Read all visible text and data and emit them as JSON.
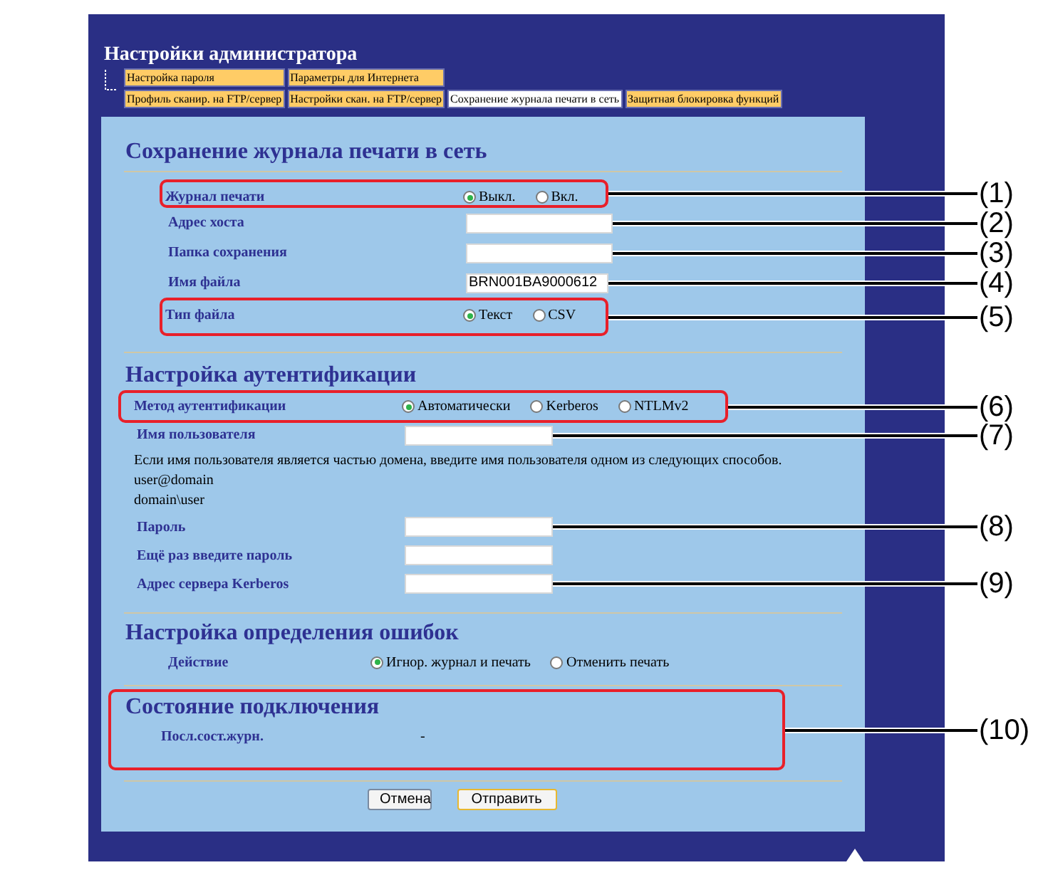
{
  "page_title": "Настройки администратора",
  "tab_rows": [
    {
      "tabs": [
        {
          "label": "Настройка пароля",
          "selected": false
        },
        {
          "label": "Параметры для Интернета",
          "selected": false
        }
      ]
    },
    {
      "tabs": [
        {
          "label": "Профиль сканир. на FTP/сервер",
          "selected": false
        },
        {
          "label": "Настройки скан. на FTP/сервер",
          "selected": false
        },
        {
          "label": "Сохранение журнала печати в сеть",
          "selected": true
        },
        {
          "label": "Защитная блокировка функций",
          "selected": false
        }
      ]
    }
  ],
  "sections": [
    {
      "title": "Сохранение журнала печати в сеть",
      "highlighted": false,
      "rows": [
        {
          "kind": "radio",
          "label": "Журнал печати",
          "highlighted": true,
          "callout": "(1)",
          "options": [
            {
              "label": "Выкл.",
              "selected": true
            },
            {
              "label": "Вкл.",
              "selected": false
            }
          ]
        },
        {
          "kind": "input",
          "label": "Адрес хоста",
          "highlighted": false,
          "callout": "(2)"
        },
        {
          "kind": "input",
          "label": "Папка сохранения",
          "highlighted": false,
          "callout": "(3)"
        },
        {
          "kind": "input",
          "label": "Имя файла",
          "highlighted": false,
          "callout": "(4)",
          "value": "BRN001BA9000612"
        },
        {
          "kind": "radio",
          "label": "Тип файла",
          "highlighted": true,
          "callout": "(5)",
          "options": [
            {
              "label": "Текст",
              "selected": true
            },
            {
              "label": "CSV",
              "selected": false
            }
          ]
        }
      ]
    },
    {
      "title": "Настройка аутентификации",
      "highlighted": false,
      "rows": [
        {
          "kind": "radio",
          "label": "Метод аутентификации",
          "highlighted": true,
          "callout": "(6)",
          "options": [
            {
              "label": "Автоматически",
              "selected": true
            },
            {
              "label": "Kerberos",
              "selected": false
            },
            {
              "label": "NTLMv2",
              "selected": false
            }
          ]
        },
        {
          "kind": "input",
          "label": "Имя пользователя",
          "highlighted": false,
          "callout": "(7)"
        },
        {
          "kind": "note",
          "lines": [
            "Если имя пользователя является частью домена, введите имя пользователя одном из следующих способов.",
            "user@domain",
            "domain\\user"
          ]
        },
        {
          "kind": "input",
          "label": "Пароль",
          "highlighted": false,
          "callout": "(8)"
        },
        {
          "kind": "input",
          "label": "Ещё раз введите пароль",
          "highlighted": false
        },
        {
          "kind": "input",
          "label": "Адрес сервера Kerberos",
          "highlighted": false,
          "callout": "(9)"
        }
      ]
    },
    {
      "title": "Настройка определения ошибок",
      "highlighted": false,
      "rows": [
        {
          "kind": "radio",
          "label": "Действие",
          "highlighted": false,
          "options": [
            {
              "label": "Игнор. журнал и печать",
              "selected": true
            },
            {
              "label": "Отменить печать",
              "selected": false
            }
          ]
        }
      ]
    },
    {
      "title": "Состояние подключения",
      "highlighted": true,
      "callout": "(10)",
      "rows": [
        {
          "kind": "value",
          "label": "Посл.сост.журн.",
          "value": "-"
        }
      ]
    }
  ],
  "buttons": [
    {
      "label": "Отмена",
      "focused": false
    },
    {
      "label": "Отправить",
      "focused": true
    }
  ]
}
